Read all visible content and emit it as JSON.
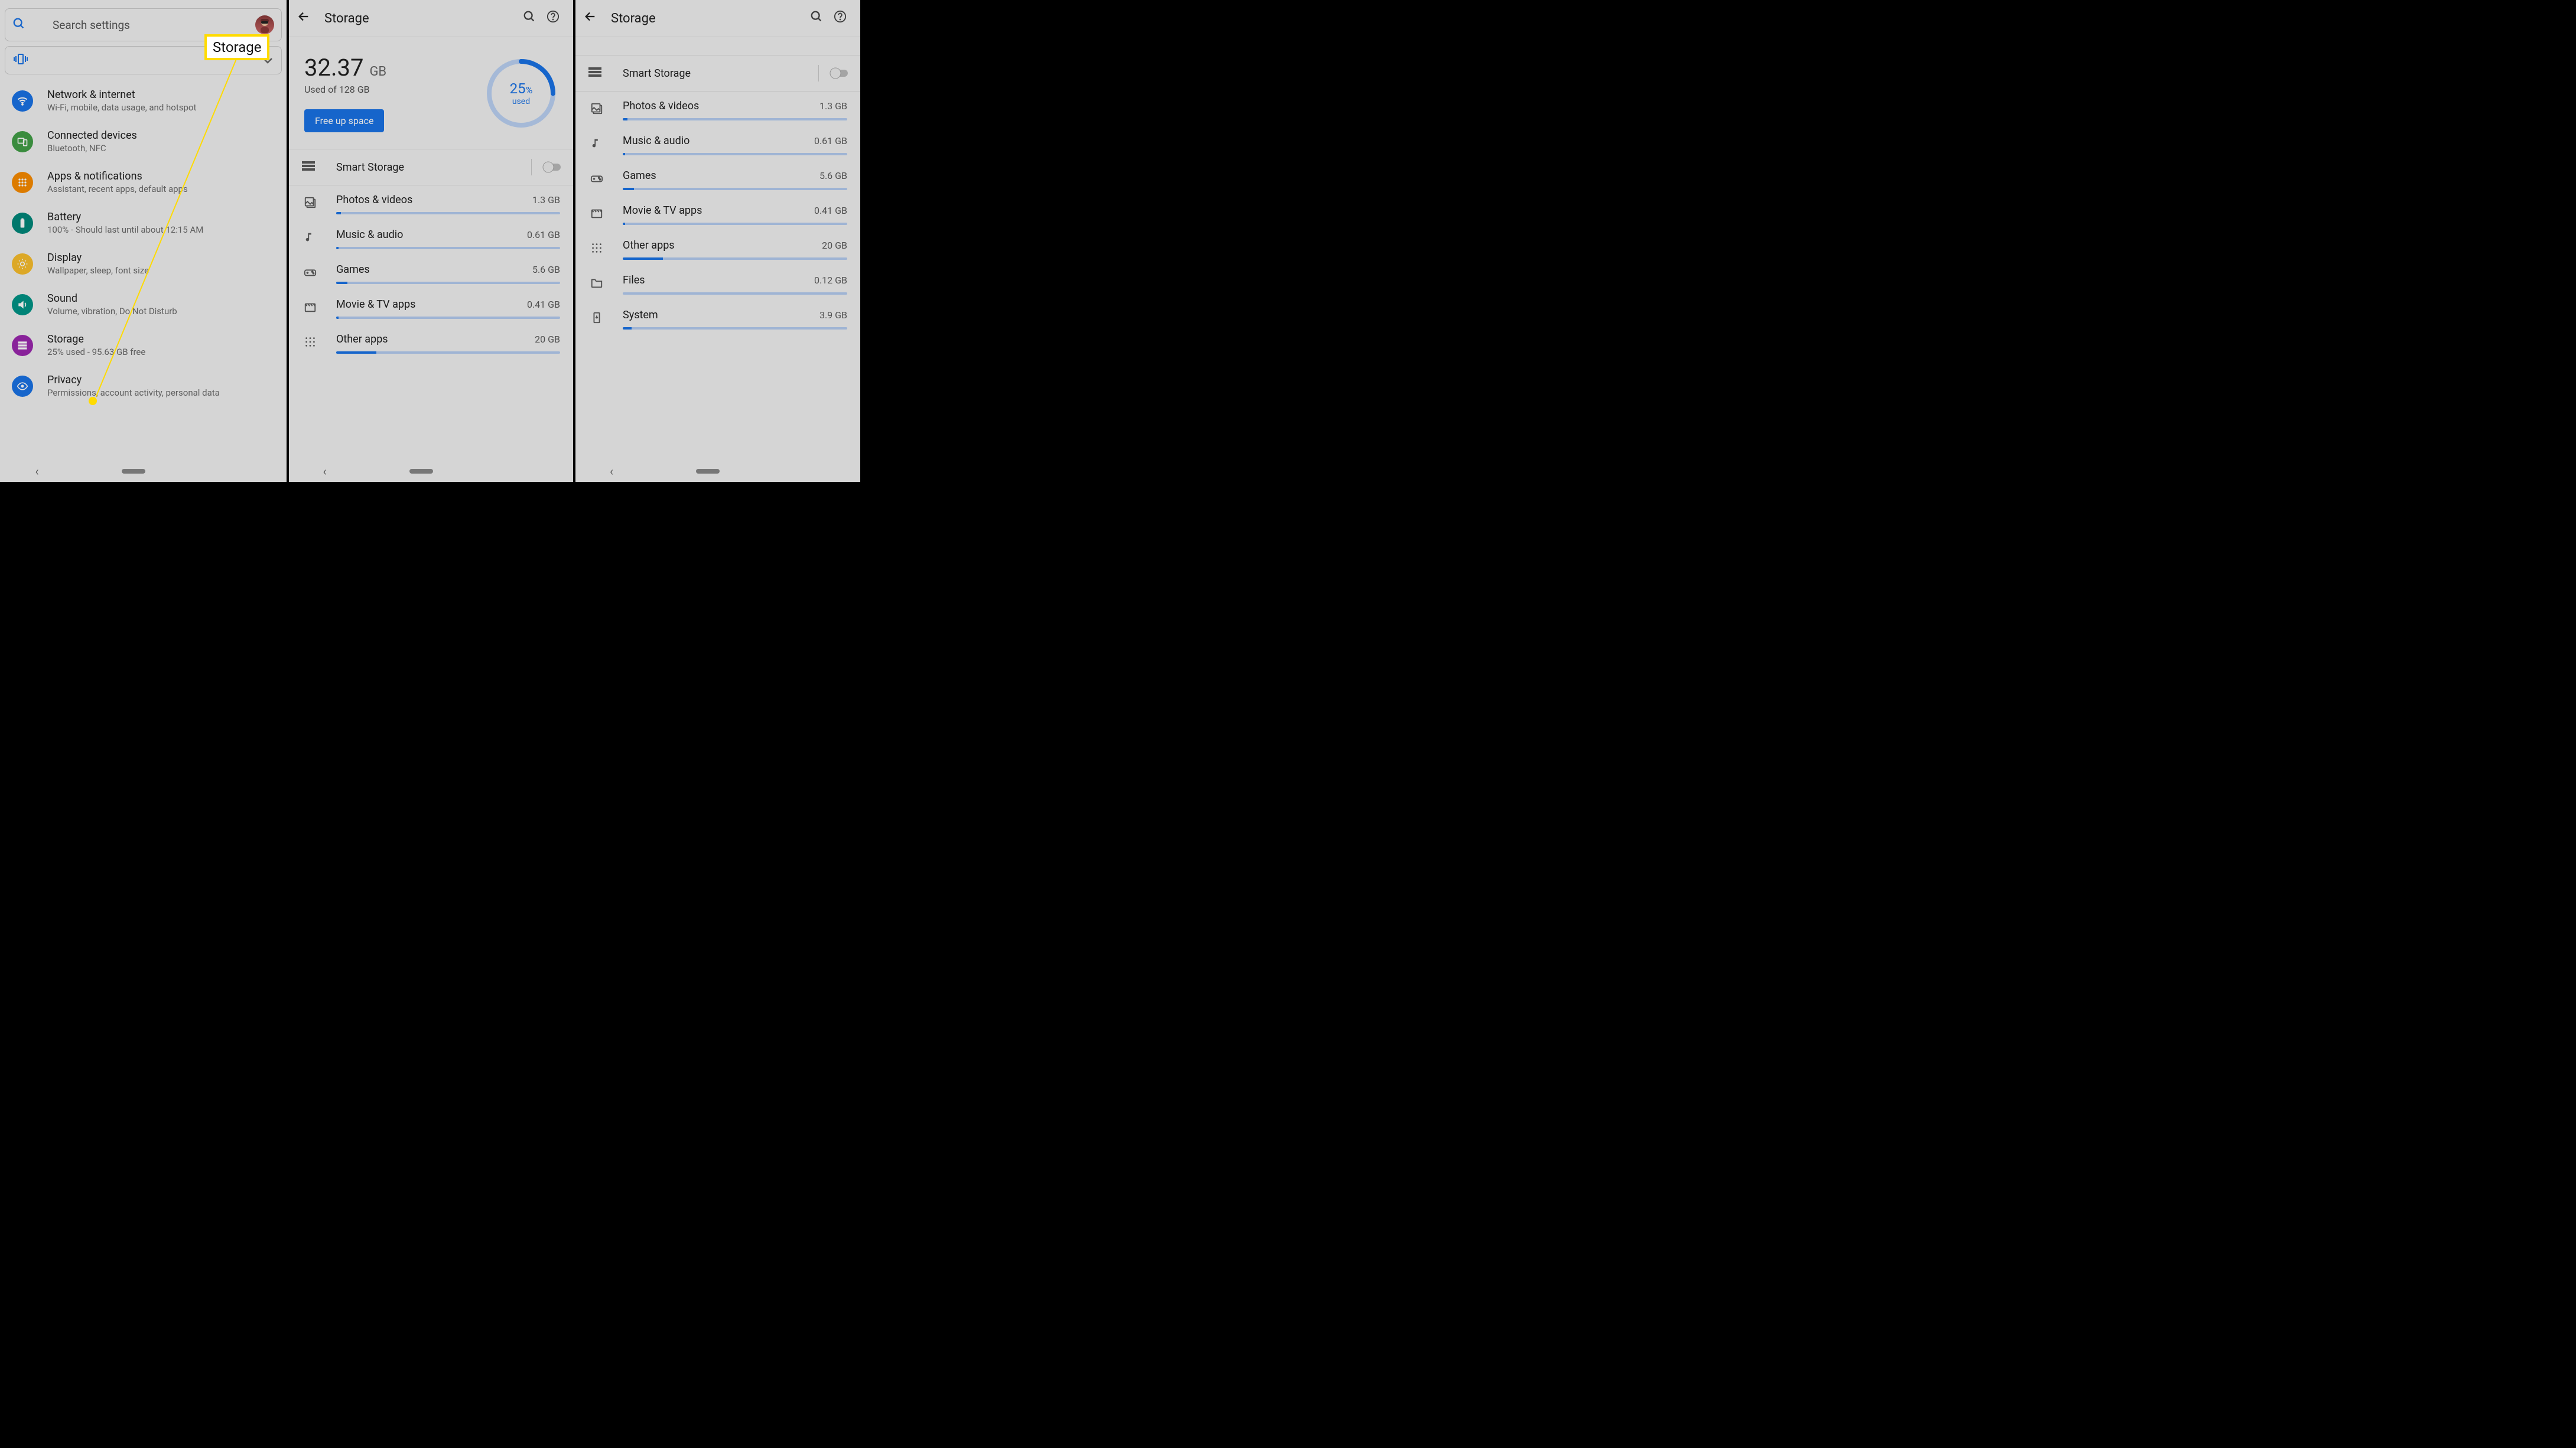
{
  "panel1": {
    "search_placeholder": "Search settings",
    "callout": "Storage",
    "items": [
      {
        "title": "Network & internet",
        "sub": "Wi-Fi, mobile, data usage, and hotspot",
        "color": "#1a73e8",
        "icon": "wifi"
      },
      {
        "title": "Connected devices",
        "sub": "Bluetooth, NFC",
        "color": "#43a047",
        "icon": "devices"
      },
      {
        "title": "Apps & notifications",
        "sub": "Assistant, recent apps, default apps",
        "color": "#fb8c00",
        "icon": "apps"
      },
      {
        "title": "Battery",
        "sub": "100% - Should last until about 12:15 AM",
        "color": "#00897b",
        "icon": "battery"
      },
      {
        "title": "Display",
        "sub": "Wallpaper, sleep, font size",
        "color": "#fbc02d",
        "icon": "brightness"
      },
      {
        "title": "Sound",
        "sub": "Volume, vibration, Do Not Disturb",
        "color": "#009688",
        "icon": "sound"
      },
      {
        "title": "Storage",
        "sub": "25% used - 95.63 GB free",
        "color": "#9c27b0",
        "icon": "storage"
      },
      {
        "title": "Privacy",
        "sub": "Permissions, account activity, personal data",
        "color": "#1a73e8",
        "icon": "privacy"
      }
    ]
  },
  "panel2": {
    "title": "Storage",
    "amount": "32.37",
    "unit": "GB",
    "used_of": "Used of 128 GB",
    "free_btn": "Free up space",
    "percent": "25",
    "percent_sym": "%",
    "used_label": "used",
    "smart": "Smart Storage",
    "cats": [
      {
        "title": "Photos & videos",
        "amt": "1.3 GB",
        "fill": 2,
        "icon": "photo"
      },
      {
        "title": "Music & audio",
        "amt": "0.61 GB",
        "fill": 1,
        "icon": "music"
      },
      {
        "title": "Games",
        "amt": "5.6 GB",
        "fill": 5,
        "icon": "games"
      },
      {
        "title": "Movie & TV apps",
        "amt": "0.41 GB",
        "fill": 1,
        "icon": "movie"
      },
      {
        "title": "Other apps",
        "amt": "20 GB",
        "fill": 18,
        "icon": "other"
      }
    ]
  },
  "panel3": {
    "title": "Storage",
    "smart": "Smart Storage",
    "cats": [
      {
        "title": "Photos & videos",
        "amt": "1.3 GB",
        "fill": 2,
        "icon": "photo"
      },
      {
        "title": "Music & audio",
        "amt": "0.61 GB",
        "fill": 1,
        "icon": "music"
      },
      {
        "title": "Games",
        "amt": "5.6 GB",
        "fill": 5,
        "icon": "games"
      },
      {
        "title": "Movie & TV apps",
        "amt": "0.41 GB",
        "fill": 1,
        "icon": "movie"
      },
      {
        "title": "Other apps",
        "amt": "20 GB",
        "fill": 18,
        "icon": "other"
      },
      {
        "title": "Files",
        "amt": "0.12 GB",
        "fill": 0,
        "icon": "files"
      },
      {
        "title": "System",
        "amt": "3.9 GB",
        "fill": 4,
        "icon": "system"
      }
    ]
  }
}
